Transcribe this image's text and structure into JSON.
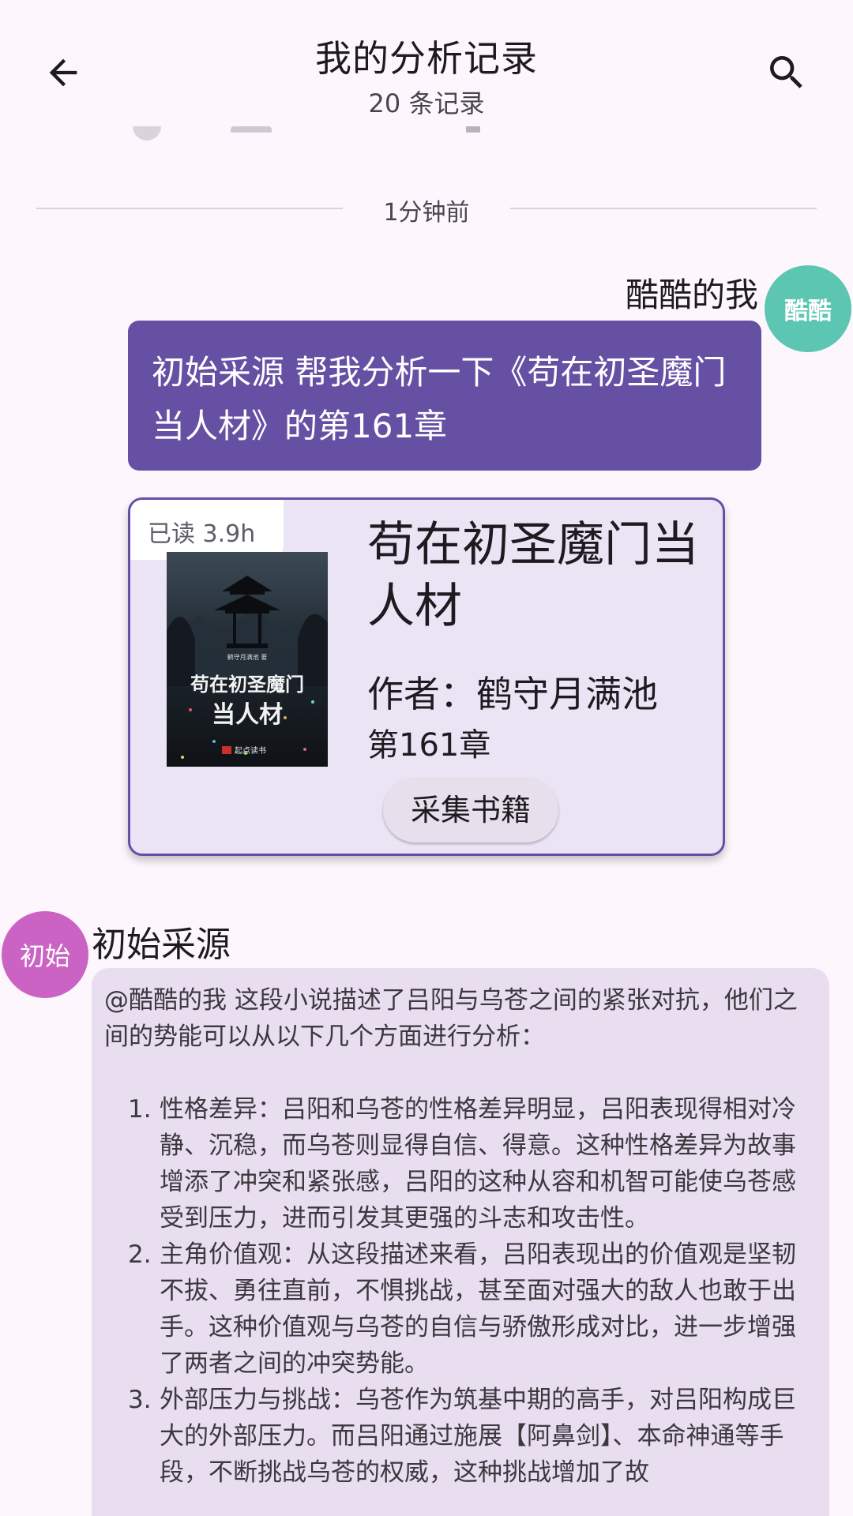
{
  "appbar": {
    "title": "我的分析记录",
    "subtitle": "20 条记录",
    "back_icon": "arrow-back-icon",
    "search_icon": "search-icon"
  },
  "divider": {
    "time": "1分钟前"
  },
  "user_message": {
    "name": "酷酷的我",
    "avatar_text": "酷酷",
    "avatar_color": "#5cc6b2",
    "text": "初始采源 帮我分析一下《苟在初圣魔门当人材》的第161章",
    "bubble_color": "#6650a4"
  },
  "book_card": {
    "read_badge": "已读 3.9h",
    "title": "苟在初圣魔门当人材",
    "author": "作者：鹤守月满池",
    "chapter": "第161章",
    "collect_button": "采集书籍",
    "cover": {
      "author_line": "鹤守月满池 著",
      "title_line1": "苟在初圣魔门",
      "title_line2": "当人材",
      "publisher": "起点读书"
    }
  },
  "bot_message": {
    "name": "初始采源",
    "avatar_text": "初始",
    "avatar_color": "#cb63c4",
    "intro": "@酷酷的我 这段小说描述了吕阳与乌苍之间的紧张对抗，他们之间的势能可以从以下几个方面进行分析：",
    "items": [
      {
        "num": "1.",
        "text": "性格差异：吕阳和乌苍的性格差异明显，吕阳表现得相对冷静、沉稳，而乌苍则显得自信、得意。这种性格差异为故事增添了冲突和紧张感，吕阳的这种从容和机智可能使乌苍感受到压力，进而引发其更强的斗志和攻击性。"
      },
      {
        "num": "2.",
        "text": "主角价值观：从这段描述来看，吕阳表现出的价值观是坚韧不拔、勇往直前，不惧挑战，甚至面对强大的敌人也敢于出手。这种价值观与乌苍的自信与骄傲形成对比，进一步增强了两者之间的冲突势能。"
      },
      {
        "num": "3.",
        "text": "外部压力与挑战：乌苍作为筑基中期的高手，对吕阳构成巨大的外部压力。而吕阳通过施展【阿鼻剑】、本命神通等手段，不断挑战乌苍的权威，这种挑战增加了故"
      }
    ]
  }
}
